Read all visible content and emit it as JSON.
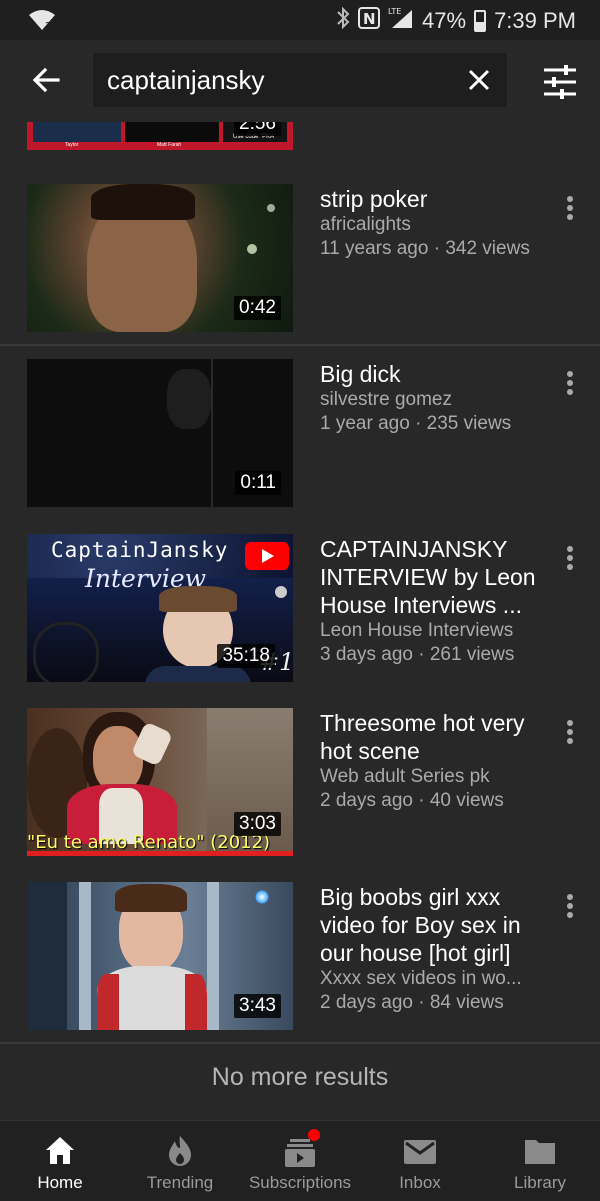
{
  "status_bar": {
    "battery": "47%",
    "time": "7:39 PM",
    "network": "LTE",
    "battery_level": 0.47
  },
  "search": {
    "query": "captainjansky"
  },
  "partial_item": {
    "duration": "2:56",
    "overlay_texts": [
      "Taylor",
      "Matt Farah",
      "Use code \"PKA\""
    ]
  },
  "results": [
    {
      "title": "strip poker",
      "channel": "africalights",
      "age_views": "11 years ago · 342 views",
      "duration": "0:42"
    },
    {
      "title": "Big dick",
      "channel": "silvestre gomez",
      "age_views": "1 year ago · 235 views",
      "duration": "0:11"
    },
    {
      "title": "CAPTAINJANSKY INTERVIEW by Leon House Interviews ...",
      "channel": "Leon House Interviews",
      "age_views": "3 days ago · 261 views",
      "duration": "35:18",
      "thumb_text_1": "CaptainJansky",
      "thumb_text_2": "Interview",
      "thumb_text_3": "#1"
    },
    {
      "title": "Threesome hot very hot scene",
      "channel": "Web adult Series pk",
      "age_views": "2 days ago · 40 views",
      "duration": "3:03",
      "thumb_caption": "\"Eu te amo Renato\" (2012)"
    },
    {
      "title": "Big boobs girl xxx video for Boy sex in our house [hot girl]",
      "channel": "Xxxx sex videos in wo...",
      "age_views": "2 days ago · 84 views",
      "duration": "3:43"
    }
  ],
  "no_more_results": "No more results",
  "bottom_nav": [
    {
      "label": "Home",
      "icon": "home-icon",
      "active": true
    },
    {
      "label": "Trending",
      "icon": "flame-icon",
      "active": false
    },
    {
      "label": "Subscriptions",
      "icon": "subscriptions-icon",
      "active": false,
      "has_notification": true
    },
    {
      "label": "Inbox",
      "icon": "mail-icon",
      "active": false
    },
    {
      "label": "Library",
      "icon": "folder-icon",
      "active": false
    }
  ],
  "colors": {
    "background": "#282828",
    "accent_red": "#ff0000",
    "text_secondary": "#aaaaaa"
  }
}
